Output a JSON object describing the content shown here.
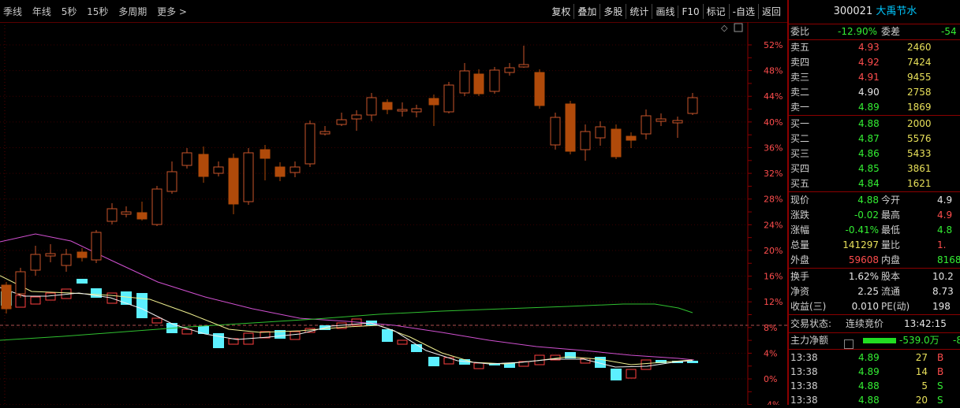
{
  "toolbar": {
    "periods": [
      "季线",
      "年线",
      "5秒",
      "15秒",
      "多周期",
      "更多 >"
    ],
    "buttons": [
      "复权",
      "叠加",
      "多股",
      "统计",
      "画线",
      "F10",
      "标记",
      "-自选",
      "返回"
    ]
  },
  "chart": {
    "y_tick_labels": [
      "52%",
      "48%",
      "44%",
      "40%",
      "36%",
      "32%",
      "28%",
      "24%",
      "20%",
      "16%",
      "12%",
      "8%",
      "4%",
      "0%",
      "-4%"
    ],
    "colors": {
      "up": "#ff4040",
      "down_candle": "#b04a0a",
      "up_candle": "#c8552a",
      "volume_down": "#5cf0ff",
      "ma_magenta": "#d050d0",
      "ma_green": "#30c030",
      "ma_yellow": "#f0f090",
      "ma_white": "#f0f0f0",
      "ref_line": "#b05050"
    }
  },
  "panel": {
    "code": "300021",
    "name": "大禹节水",
    "weibi_label": "委比",
    "weibi_value": "-12.90%",
    "weicha_label": "委差",
    "weicha_value": "-54",
    "asks": [
      {
        "label": "卖五",
        "price": "4.93",
        "vol": "2460"
      },
      {
        "label": "卖四",
        "price": "4.92",
        "vol": "7424"
      },
      {
        "label": "卖三",
        "price": "4.91",
        "vol": "9455"
      },
      {
        "label": "卖二",
        "price": "4.90",
        "vol": "2758"
      },
      {
        "label": "卖一",
        "price": "4.89",
        "vol": "1869"
      }
    ],
    "bids": [
      {
        "label": "买一",
        "price": "4.88",
        "vol": "2000"
      },
      {
        "label": "买二",
        "price": "4.87",
        "vol": "5576"
      },
      {
        "label": "买三",
        "price": "4.86",
        "vol": "5433"
      },
      {
        "label": "买四",
        "price": "4.85",
        "vol": "3861"
      },
      {
        "label": "买五",
        "price": "4.84",
        "vol": "1621"
      }
    ],
    "quote": [
      {
        "l1": "现价",
        "v1": "4.88",
        "l2": "今开",
        "v2": "4.9"
      },
      {
        "l1": "涨跌",
        "v1": "-0.02",
        "l2": "最高",
        "v2": "4.9"
      },
      {
        "l1": "涨幅",
        "v1": "-0.41%",
        "l2": "最低",
        "v2": "4.8"
      },
      {
        "l1": "总量",
        "v1": "141297",
        "l2": "量比",
        "v2": "1."
      },
      {
        "l1": "外盘",
        "v1": "59608",
        "l2": "内盘",
        "v2": "8168"
      }
    ],
    "stats": [
      {
        "l1": "换手",
        "v1": "1.62%",
        "l2": "股本",
        "v2": "10.2"
      },
      {
        "l1": "净资",
        "v1": "2.25",
        "l2": "流通",
        "v2": "8.73"
      },
      {
        "l1": "收益(三)",
        "v1": "0.010",
        "l2": "PE(动)",
        "v2": "198"
      }
    ],
    "trade_state_label": "交易状态:",
    "trade_state_value": "连续竞价",
    "trade_time": "13:42:15",
    "main_flow_label": "主力净额",
    "main_flow_value": "-539.0万",
    "main_flow_extra": "-8",
    "ticks": [
      {
        "time": "13:38",
        "price": "4.89",
        "vol": "27",
        "side": "B"
      },
      {
        "time": "13:38",
        "price": "4.89",
        "vol": "14",
        "side": "B"
      },
      {
        "time": "13:38",
        "price": "4.88",
        "vol": "5",
        "side": "S"
      },
      {
        "time": "13:38",
        "price": "4.88",
        "vol": "20",
        "side": "S"
      }
    ]
  }
}
